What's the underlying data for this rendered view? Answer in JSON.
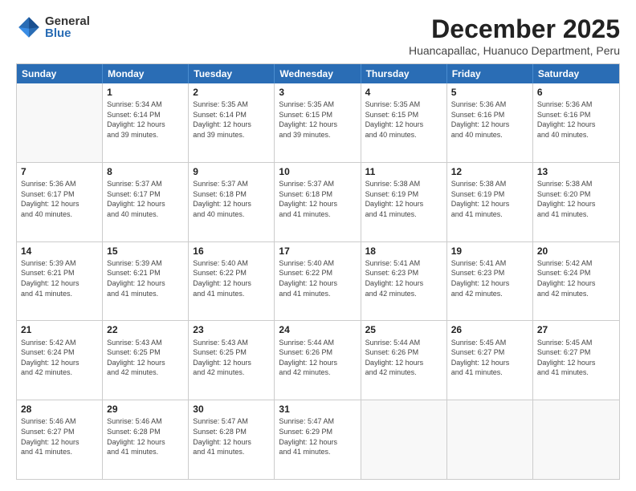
{
  "logo": {
    "general": "General",
    "blue": "Blue"
  },
  "header": {
    "month": "December 2025",
    "location": "Huancapallac, Huanuco Department, Peru"
  },
  "weekdays": [
    "Sunday",
    "Monday",
    "Tuesday",
    "Wednesday",
    "Thursday",
    "Friday",
    "Saturday"
  ],
  "rows": [
    [
      {
        "day": "",
        "info": ""
      },
      {
        "day": "1",
        "info": "Sunrise: 5:34 AM\nSunset: 6:14 PM\nDaylight: 12 hours\nand 39 minutes."
      },
      {
        "day": "2",
        "info": "Sunrise: 5:35 AM\nSunset: 6:14 PM\nDaylight: 12 hours\nand 39 minutes."
      },
      {
        "day": "3",
        "info": "Sunrise: 5:35 AM\nSunset: 6:15 PM\nDaylight: 12 hours\nand 39 minutes."
      },
      {
        "day": "4",
        "info": "Sunrise: 5:35 AM\nSunset: 6:15 PM\nDaylight: 12 hours\nand 40 minutes."
      },
      {
        "day": "5",
        "info": "Sunrise: 5:36 AM\nSunset: 6:16 PM\nDaylight: 12 hours\nand 40 minutes."
      },
      {
        "day": "6",
        "info": "Sunrise: 5:36 AM\nSunset: 6:16 PM\nDaylight: 12 hours\nand 40 minutes."
      }
    ],
    [
      {
        "day": "7",
        "info": "Sunrise: 5:36 AM\nSunset: 6:17 PM\nDaylight: 12 hours\nand 40 minutes."
      },
      {
        "day": "8",
        "info": "Sunrise: 5:37 AM\nSunset: 6:17 PM\nDaylight: 12 hours\nand 40 minutes."
      },
      {
        "day": "9",
        "info": "Sunrise: 5:37 AM\nSunset: 6:18 PM\nDaylight: 12 hours\nand 40 minutes."
      },
      {
        "day": "10",
        "info": "Sunrise: 5:37 AM\nSunset: 6:18 PM\nDaylight: 12 hours\nand 41 minutes."
      },
      {
        "day": "11",
        "info": "Sunrise: 5:38 AM\nSunset: 6:19 PM\nDaylight: 12 hours\nand 41 minutes."
      },
      {
        "day": "12",
        "info": "Sunrise: 5:38 AM\nSunset: 6:19 PM\nDaylight: 12 hours\nand 41 minutes."
      },
      {
        "day": "13",
        "info": "Sunrise: 5:38 AM\nSunset: 6:20 PM\nDaylight: 12 hours\nand 41 minutes."
      }
    ],
    [
      {
        "day": "14",
        "info": "Sunrise: 5:39 AM\nSunset: 6:21 PM\nDaylight: 12 hours\nand 41 minutes."
      },
      {
        "day": "15",
        "info": "Sunrise: 5:39 AM\nSunset: 6:21 PM\nDaylight: 12 hours\nand 41 minutes."
      },
      {
        "day": "16",
        "info": "Sunrise: 5:40 AM\nSunset: 6:22 PM\nDaylight: 12 hours\nand 41 minutes."
      },
      {
        "day": "17",
        "info": "Sunrise: 5:40 AM\nSunset: 6:22 PM\nDaylight: 12 hours\nand 41 minutes."
      },
      {
        "day": "18",
        "info": "Sunrise: 5:41 AM\nSunset: 6:23 PM\nDaylight: 12 hours\nand 42 minutes."
      },
      {
        "day": "19",
        "info": "Sunrise: 5:41 AM\nSunset: 6:23 PM\nDaylight: 12 hours\nand 42 minutes."
      },
      {
        "day": "20",
        "info": "Sunrise: 5:42 AM\nSunset: 6:24 PM\nDaylight: 12 hours\nand 42 minutes."
      }
    ],
    [
      {
        "day": "21",
        "info": "Sunrise: 5:42 AM\nSunset: 6:24 PM\nDaylight: 12 hours\nand 42 minutes."
      },
      {
        "day": "22",
        "info": "Sunrise: 5:43 AM\nSunset: 6:25 PM\nDaylight: 12 hours\nand 42 minutes."
      },
      {
        "day": "23",
        "info": "Sunrise: 5:43 AM\nSunset: 6:25 PM\nDaylight: 12 hours\nand 42 minutes."
      },
      {
        "day": "24",
        "info": "Sunrise: 5:44 AM\nSunset: 6:26 PM\nDaylight: 12 hours\nand 42 minutes."
      },
      {
        "day": "25",
        "info": "Sunrise: 5:44 AM\nSunset: 6:26 PM\nDaylight: 12 hours\nand 42 minutes."
      },
      {
        "day": "26",
        "info": "Sunrise: 5:45 AM\nSunset: 6:27 PM\nDaylight: 12 hours\nand 41 minutes."
      },
      {
        "day": "27",
        "info": "Sunrise: 5:45 AM\nSunset: 6:27 PM\nDaylight: 12 hours\nand 41 minutes."
      }
    ],
    [
      {
        "day": "28",
        "info": "Sunrise: 5:46 AM\nSunset: 6:27 PM\nDaylight: 12 hours\nand 41 minutes."
      },
      {
        "day": "29",
        "info": "Sunrise: 5:46 AM\nSunset: 6:28 PM\nDaylight: 12 hours\nand 41 minutes."
      },
      {
        "day": "30",
        "info": "Sunrise: 5:47 AM\nSunset: 6:28 PM\nDaylight: 12 hours\nand 41 minutes."
      },
      {
        "day": "31",
        "info": "Sunrise: 5:47 AM\nSunset: 6:29 PM\nDaylight: 12 hours\nand 41 minutes."
      },
      {
        "day": "",
        "info": ""
      },
      {
        "day": "",
        "info": ""
      },
      {
        "day": "",
        "info": ""
      }
    ]
  ]
}
